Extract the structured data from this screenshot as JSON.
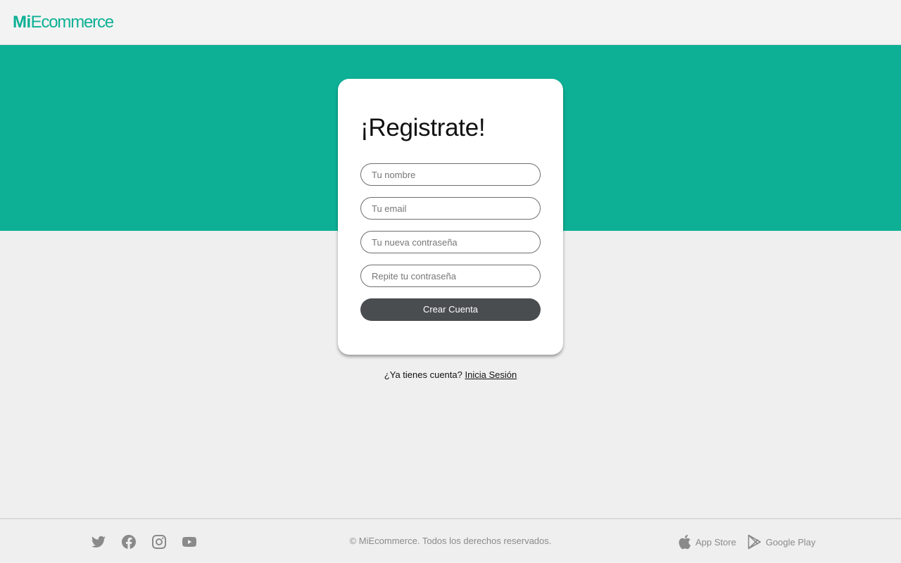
{
  "header": {
    "logo_bold": "Mi",
    "logo_light": "Ecommerce"
  },
  "colors": {
    "brand": "#0db095",
    "button": "#4a4d50",
    "page_bg": "#efefef"
  },
  "signup": {
    "title": "¡Registrate!",
    "name_placeholder": "Tu nombre",
    "email_placeholder": "Tu email",
    "password_placeholder": "Tu nueva contraseña",
    "repeat_password_placeholder": "Repite tu contraseña",
    "submit_label": "Crear Cuenta"
  },
  "login_prompt": {
    "text": "¿Ya tienes cuenta?",
    "link_label": "Inicia Sesión"
  },
  "footer": {
    "social_icons": [
      "twitter-icon",
      "facebook-icon",
      "instagram-icon",
      "youtube-icon"
    ],
    "copyright": "© MiEcommerce. Todos los derechos reservados.",
    "app_store_label": "App Store",
    "google_play_label": "Google Play"
  }
}
